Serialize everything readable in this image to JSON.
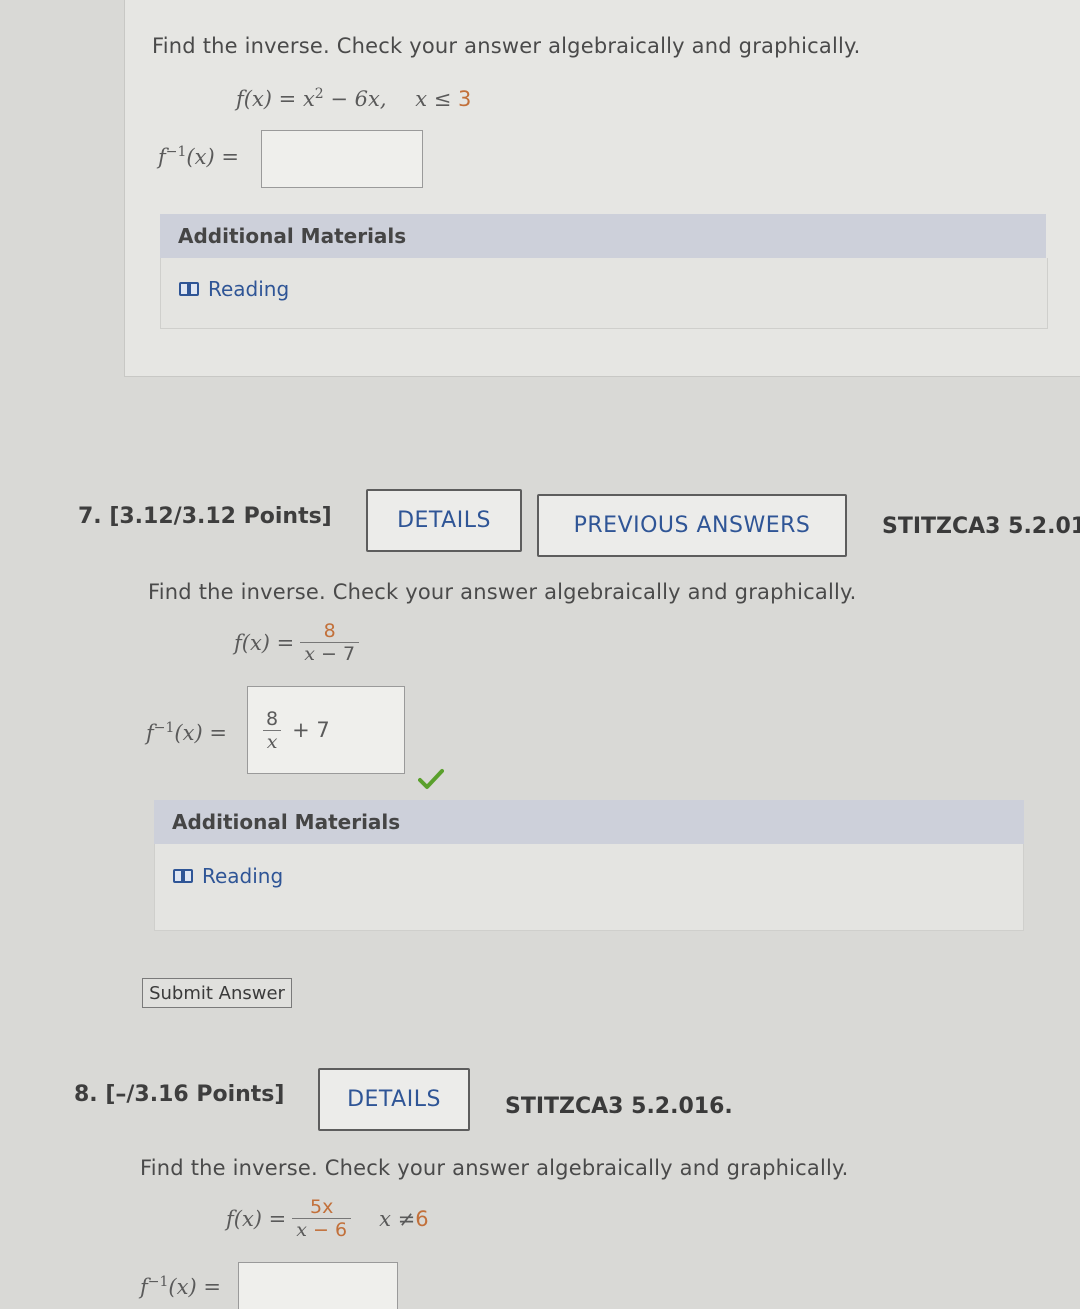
{
  "q6": {
    "prompt": "Find the inverse. Check your answer algebraically and graphically.",
    "function_lhs": "f(x) = x",
    "function_exp": "2",
    "function_rhs": " − 6x,",
    "domain_var": "x ≤ ",
    "domain_val": "3",
    "inverse_label": "f",
    "inverse_sup": "−1",
    "inverse_tail": "(x) =",
    "answer_value": "",
    "materials_title": "Additional Materials",
    "reading_label": "Reading"
  },
  "q7": {
    "number": "7. [3.12/3.12 Points]",
    "details_label": "DETAILS",
    "previous_answers_label": "PREVIOUS ANSWERS",
    "code": "STITZCA3 5.2.01",
    "prompt": "Find the inverse. Check your answer algebraically and graphically.",
    "function_lhs": "f(x) = ",
    "function_num": "8",
    "function_den_var": "x",
    "function_den_rest": " − 7",
    "inverse_label": "f",
    "inverse_sup": "−1",
    "inverse_tail": "(x) =",
    "answer_num": "8",
    "answer_den": "x",
    "answer_tail": "+ 7",
    "materials_title": "Additional Materials",
    "reading_label": "Reading",
    "submit_label": "Submit Answer"
  },
  "q8": {
    "number": "8. [–/3.16 Points]",
    "details_label": "DETAILS",
    "code": "STITZCA3 5.2.016.",
    "prompt": "Find the inverse. Check your answer algebraically and graphically.",
    "function_lhs": "f(x) = ",
    "function_num": "5x",
    "function_den_var": "x",
    "function_den_rest": " − 6",
    "domain_var": "x ≠ ",
    "domain_val": "6",
    "inverse_label": "f",
    "inverse_sup": "−1",
    "inverse_tail": "(x) =",
    "answer_value": ""
  },
  "colors": {
    "link": "#2f5596",
    "accent_orange": "#c2703a",
    "check_green": "#5aa02c"
  }
}
